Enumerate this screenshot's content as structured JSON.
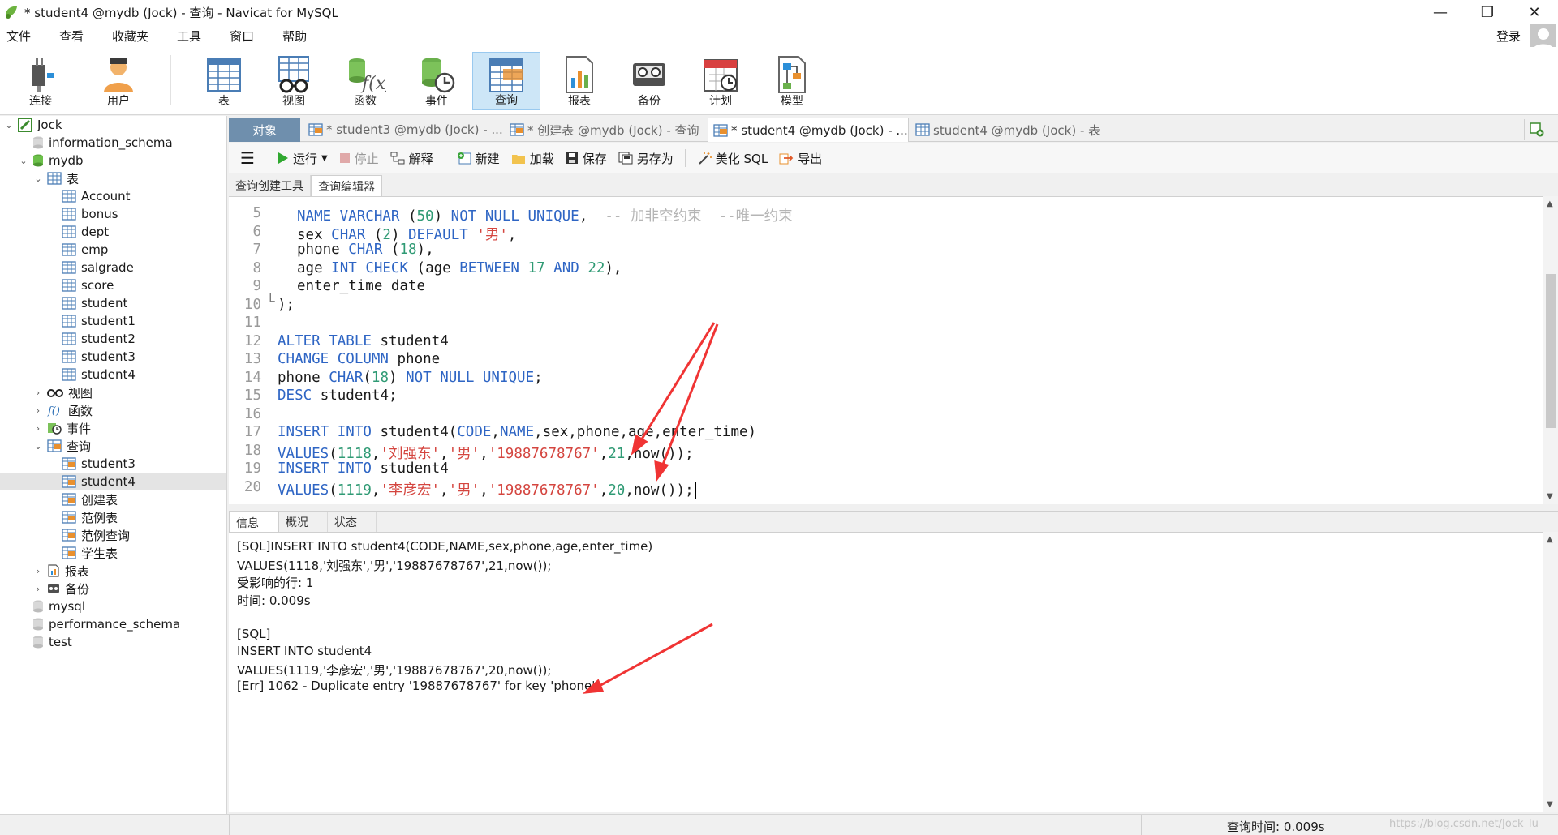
{
  "window": {
    "title": "* student4 @mydb (Jock) - 查询 - Navicat for MySQL",
    "minimize": "—",
    "maximize": "❐",
    "close": "✕"
  },
  "menu": [
    "文件",
    "查看",
    "收藏夹",
    "工具",
    "窗口",
    "帮助"
  ],
  "account": {
    "login_label": "登录"
  },
  "toolbar": [
    {
      "label": "连接",
      "icon": "connection-plug-icon"
    },
    {
      "label": "用户",
      "icon": "user-icon"
    },
    {
      "label": "表",
      "icon": "table-icon"
    },
    {
      "label": "视图",
      "icon": "view-glasses-icon"
    },
    {
      "label": "函数",
      "icon": "function-fx-icon"
    },
    {
      "label": "事件",
      "icon": "event-clock-icon"
    },
    {
      "label": "查询",
      "icon": "query-table-icon",
      "active": true
    },
    {
      "label": "报表",
      "icon": "report-chart-icon"
    },
    {
      "label": "备份",
      "icon": "backup-tape-icon"
    },
    {
      "label": "计划",
      "icon": "schedule-calendar-icon"
    },
    {
      "label": "模型",
      "icon": "model-diagram-icon"
    }
  ],
  "tree": {
    "connection": "Jock",
    "databases": [
      "information_schema",
      "mydb"
    ],
    "tables_label": "表",
    "tables": [
      "Account",
      "bonus",
      "dept",
      "emp",
      "salgrade",
      "score",
      "student",
      "student1",
      "student2",
      "student3",
      "student4"
    ],
    "views_label": "视图",
    "functions_label": "函数",
    "events_label": "事件",
    "queries_label": "查询",
    "queries": [
      "student3",
      "student4",
      "创建表",
      "范例表",
      "范例查询",
      "学生表"
    ],
    "reports_label": "报表",
    "backups_label": "备份",
    "other_databases": [
      "mysql",
      "performance_schema",
      "test"
    ]
  },
  "tabs": {
    "objects": "对象",
    "items": [
      "* student3 @mydb (Jock) - ...",
      "* 创建表 @mydb (Jock) - 查询",
      "* student4 @mydb (Jock) - ...",
      "student4 @mydb (Jock) - 表"
    ]
  },
  "query_toolbar": {
    "run": "运行",
    "stop": "停止",
    "explain": "解释",
    "new": "新建",
    "load": "加载",
    "save": "保存",
    "save_as": "另存为",
    "beautify": "美化 SQL",
    "export": "导出"
  },
  "editor_tabs": [
    "查询创建工具",
    "查询编辑器"
  ],
  "code": {
    "line_numbers": [
      "5",
      "6",
      "7",
      "8",
      "9",
      "10",
      "11",
      "12",
      "13",
      "14",
      "15",
      "16",
      "17",
      "18",
      "19",
      "20"
    ],
    "l5": {
      "a": "NAME VARCHAR",
      "b": " (",
      "c": "50",
      "d": ") ",
      "e": "NOT NULL UNIQUE",
      ",": ",",
      "cm": "  -- 加非空约束  --唯一约束"
    },
    "l6": {
      "a": "sex ",
      "b": "CHAR",
      "c": " (",
      "d": "2",
      "e": ") ",
      "f": "DEFAULT",
      "g": " ",
      "h": "'男'",
      "i": ","
    },
    "l7": {
      "a": "phone ",
      "b": "CHAR",
      "c": " (",
      "d": "18",
      "e": "),"
    },
    "l8": {
      "a": "age ",
      "b": "INT",
      "c": " ",
      "d": "CHECK",
      "e": " (age ",
      "f": "BETWEEN",
      "g": " ",
      "h": "17",
      "i": " ",
      "j": "AND",
      "k": " ",
      "l": "22",
      "m": "),"
    },
    "l9": {
      "a": "enter_time date"
    },
    "l10": {
      "a": ");"
    },
    "l12": {
      "a": "ALTER TABLE",
      "b": " student4"
    },
    "l13": {
      "a": "CHANGE COLUMN",
      "b": " phone"
    },
    "l14": {
      "a": "phone ",
      "b": "CHAR",
      "c": "(",
      "d": "18",
      "e": ") ",
      "f": "NOT NULL UNIQUE",
      "g": ";"
    },
    "l15": {
      "a": "DESC",
      "b": " student4;"
    },
    "l17": {
      "a": "INSERT INTO",
      "b": " student4(",
      "c": "CODE",
      "d": ",",
      "e": "NAME",
      "f": ",sex,phone,age,enter_time)"
    },
    "l18": {
      "a": "VALUES",
      "b": "(",
      "c": "1118",
      "d": ",",
      "e": "'刘强东'",
      "f": ",",
      "g": "'男'",
      "h": ",",
      "i": "'19887678767'",
      "j": ",",
      "k": "21",
      "l": ",now());"
    },
    "l19": {
      "a": "INSERT INTO",
      "b": " student4"
    },
    "l20": {
      "a": "VALUES",
      "b": "(",
      "c": "1119",
      "d": ",",
      "e": "'李彦宏'",
      "f": ",",
      "g": "'男'",
      "h": ",",
      "i": "'19887678767'",
      "j": ",",
      "k": "20",
      "l": ",now());"
    }
  },
  "result_tabs": [
    "信息",
    "概况",
    "状态"
  ],
  "result_lines": [
    "[SQL]INSERT INTO student4(CODE,NAME,sex,phone,age,enter_time)",
    "VALUES(1118,'刘强东','男','19887678767',21,now());",
    "受影响的行: 1",
    "时间: 0.009s",
    "",
    "[SQL]",
    "INSERT INTO student4",
    "VALUES(1119,'李彦宏','男','19887678767',20,now());",
    "[Err] 1062 - Duplicate entry '19887678767' for key 'phone'"
  ],
  "status": {
    "query_time": "查询时间: 0.009s",
    "watermark": "https://blog.csdn.net/Jock_lu"
  },
  "colors": {
    "keyword": "#2e65c4",
    "string": "#d4453f",
    "number": "#2f9a74",
    "comment": "#b5b5b5",
    "annotation_arrow": "#f03434",
    "active_tab": "#6f8fad"
  }
}
